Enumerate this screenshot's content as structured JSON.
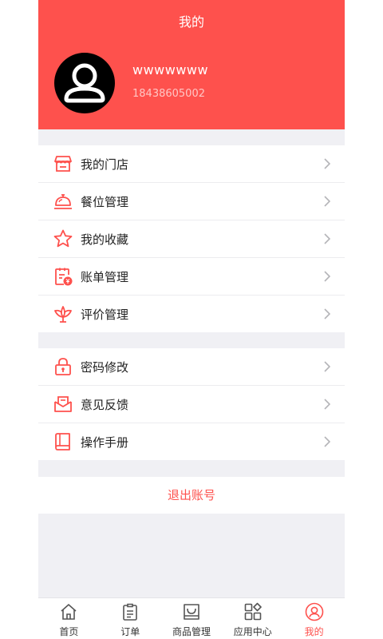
{
  "header": {
    "title": "我的",
    "username": "wwwwwww",
    "phone": "18438605002"
  },
  "menu_group1": [
    {
      "label": "我的门店",
      "icon": "store-icon"
    },
    {
      "label": "餐位管理",
      "icon": "dining-bell-icon"
    },
    {
      "label": "我的收藏",
      "icon": "star-icon"
    },
    {
      "label": "账单管理",
      "icon": "bill-icon"
    },
    {
      "label": "评价管理",
      "icon": "lotus-icon"
    }
  ],
  "menu_group2": [
    {
      "label": "密码修改",
      "icon": "lock-icon"
    },
    {
      "label": "意见反馈",
      "icon": "feedback-mail-icon"
    },
    {
      "label": "操作手册",
      "icon": "book-icon"
    }
  ],
  "logout_label": "退出账号",
  "tabbar": [
    {
      "label": "首页",
      "icon": "home-icon",
      "active": false
    },
    {
      "label": "订单",
      "icon": "order-icon",
      "active": false
    },
    {
      "label": "商品管理",
      "icon": "goods-bag-icon",
      "active": false
    },
    {
      "label": "应用中心",
      "icon": "apps-icon",
      "active": false
    },
    {
      "label": "我的",
      "icon": "profile-icon",
      "active": true
    }
  ],
  "colors": {
    "accent": "#fe514d",
    "background": "#f0f0f4",
    "text": "#222222"
  }
}
